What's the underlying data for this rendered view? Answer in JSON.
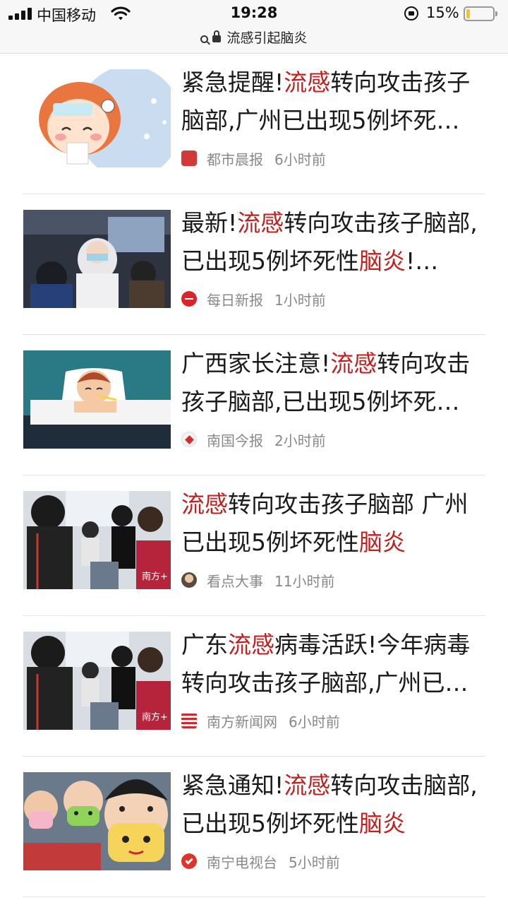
{
  "status": {
    "carrier": "中国移动",
    "time": "19:28",
    "battery_pct": "15%",
    "battery_level": 0.15
  },
  "url": {
    "text": "流感引起脑炎"
  },
  "colors": {
    "highlight": "#c21f1f",
    "meta": "#888888"
  },
  "items": [
    {
      "title_parts": [
        {
          "text": "紧急提醒!",
          "hl": false
        },
        {
          "text": "流感",
          "hl": true
        },
        {
          "text": "转向攻击孩子脑部,广州已出现5例坏死…",
          "hl": false
        }
      ],
      "source": "都市晨报",
      "time": "6小时前",
      "source_icon": "dushi-chenbao-logo-icon",
      "thumb": "sick-cartoon-girl"
    },
    {
      "title_parts": [
        {
          "text": "最新!",
          "hl": false
        },
        {
          "text": "流感",
          "hl": true
        },
        {
          "text": "转向攻击孩子脑部,已出现5例坏死性",
          "hl": false
        },
        {
          "text": "脑炎",
          "hl": true
        },
        {
          "text": "!…",
          "hl": false
        }
      ],
      "source": "每日新报",
      "time": "1小时前",
      "source_icon": "meiri-xinbao-logo-icon",
      "thumb": "hospital-nurse"
    },
    {
      "title_parts": [
        {
          "text": "广西家长注意!",
          "hl": false
        },
        {
          "text": "流感",
          "hl": true
        },
        {
          "text": "转向攻击孩子脑部,已出现5例坏死…",
          "hl": false
        }
      ],
      "source": "南国今报",
      "time": "2小时前",
      "source_icon": "nanguo-jinbao-logo-icon",
      "thumb": "sick-child-in-bed"
    },
    {
      "title_parts": [
        {
          "text": "流感",
          "hl": true
        },
        {
          "text": "转向攻击孩子脑部 广州已出现5例坏死性",
          "hl": false
        },
        {
          "text": "脑炎",
          "hl": true
        }
      ],
      "source": "看点大事",
      "time": "11小时前",
      "source_icon": "kandian-dashi-logo-icon",
      "thumb": "clinic-crowd"
    },
    {
      "title_parts": [
        {
          "text": "广东",
          "hl": false
        },
        {
          "text": "流感",
          "hl": true
        },
        {
          "text": "病毒活跃!今年病毒转向攻击孩子脑部,广州已…",
          "hl": false
        }
      ],
      "source": "南方新闻网",
      "time": "6小时前",
      "source_icon": "nanfang-news-logo-icon",
      "thumb": "clinic-crowd"
    },
    {
      "title_parts": [
        {
          "text": "紧急通知!",
          "hl": false
        },
        {
          "text": "流感",
          "hl": true
        },
        {
          "text": "转向攻击脑部,已出现5例坏死性",
          "hl": false
        },
        {
          "text": "脑炎",
          "hl": true
        }
      ],
      "source": "南宁电视台",
      "time": "5小时前",
      "source_icon": "nanning-tv-logo-icon",
      "thumb": "kids-with-masks"
    }
  ]
}
